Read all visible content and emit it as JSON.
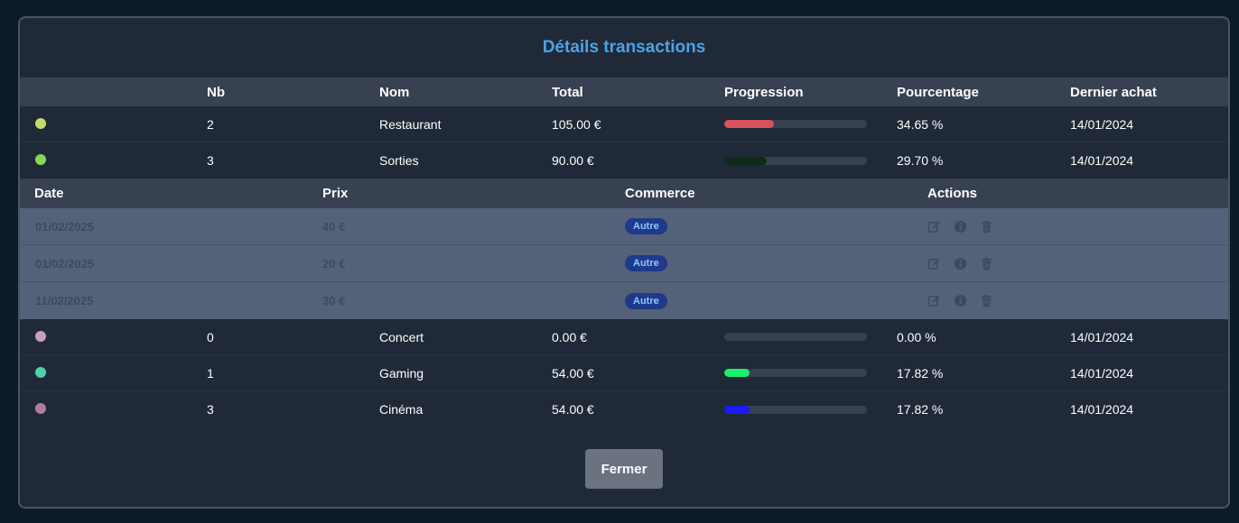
{
  "modal": {
    "title": "Détails transactions",
    "close_label": "Fermer"
  },
  "main_table": {
    "headers": [
      "",
      "Nb",
      "Nom",
      "Total",
      "Progression",
      "Pourcentage",
      "Dernier achat"
    ],
    "rows": [
      {
        "dot_color": "#c5dc6c",
        "nb": "2",
        "nom": "Restaurant",
        "total": "105.00 €",
        "progress": 0.3465,
        "bar_color": "#d9535d",
        "pct": "34.65 %",
        "last": "14/01/2024"
      },
      {
        "dot_color": "#86d957",
        "nb": "3",
        "nom": "Sorties",
        "total": "90.00 €",
        "progress": 0.297,
        "bar_color": "#0e2a1a",
        "pct": "29.70 %",
        "last": "14/01/2024"
      },
      {
        "dot_color": "#c9a0b9",
        "nb": "0",
        "nom": "Concert",
        "total": "0.00 €",
        "progress": 0.0,
        "bar_color": "#374151",
        "pct": "0.00 %",
        "last": "14/01/2024"
      },
      {
        "dot_color": "#4fd1a5",
        "nb": "1",
        "nom": "Gaming",
        "total": "54.00 €",
        "progress": 0.1782,
        "bar_color": "#1cf06b",
        "pct": "17.82 %",
        "last": "14/01/2024"
      },
      {
        "dot_color": "#b27aa4",
        "nb": "3",
        "nom": "Cinéma",
        "total": "54.00 €",
        "progress": 0.1782,
        "bar_color": "#1a1aff",
        "pct": "17.82 %",
        "last": "14/01/2024"
      }
    ]
  },
  "sub_table": {
    "headers": [
      "Date",
      "Prix",
      "Commerce",
      "Actions"
    ],
    "rows": [
      {
        "date": "01/02/2025",
        "prix": "40 €",
        "commerce": "Autre"
      },
      {
        "date": "01/02/2025",
        "prix": "20 €",
        "commerce": "Autre"
      },
      {
        "date": "11/02/2025",
        "prix": "30 €",
        "commerce": "Autre"
      }
    ],
    "action_icons": [
      "edit-icon",
      "info-icon",
      "trash-icon"
    ]
  }
}
